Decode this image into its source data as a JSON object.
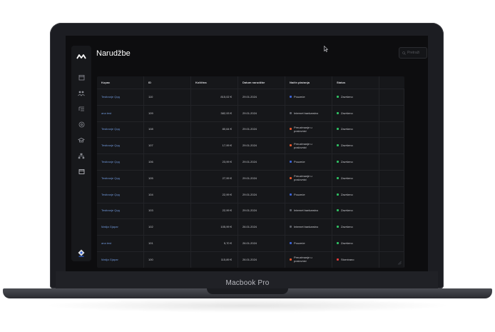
{
  "brand": "Macbook Pro",
  "page_title": "Narudžbe",
  "search": {
    "placeholder": "Pretraži"
  },
  "sidebar": {
    "items": [
      {
        "icon": "calendar-icon"
      },
      {
        "icon": "users-icon"
      },
      {
        "icon": "list-icon"
      },
      {
        "icon": "coin-icon"
      },
      {
        "icon": "graduation-cap-icon"
      },
      {
        "icon": "hierarchy-icon"
      },
      {
        "icon": "window-icon"
      }
    ]
  },
  "colors": {
    "accent": "#6e95d6",
    "paid_card": "#3b63d6",
    "bank": "#5d6068",
    "transfer": "#e8572c",
    "completed": "#2fbf62",
    "cancelled": "#e23b3b"
  },
  "table": {
    "headers": [
      "Kupac",
      "ID",
      "Količina",
      "Datum narudžbe",
      "Način plaćanja",
      "Status"
    ],
    "rows": [
      {
        "customer": "Testiranje Qqq",
        "id": "110",
        "amount": "815,02 €",
        "date": "29.01.2024",
        "payment": "Pouzeće",
        "payment_color": "blue",
        "status": "Završeno",
        "status_color": "green"
      },
      {
        "customer": "ana test",
        "id": "109",
        "amount": "382,93 €",
        "date": "29.01.2024",
        "payment": "Internet bankarstvo",
        "payment_color": "gray",
        "status": "Završeno",
        "status_color": "green"
      },
      {
        "customer": "Testiranje Qqq",
        "id": "108",
        "amount": "80,64 €",
        "date": "29.01.2024",
        "payment": "Preuzimanje u poslovnici",
        "payment_color": "orange",
        "status": "Završeno",
        "status_color": "green"
      },
      {
        "customer": "Testiranje Qqq",
        "id": "107",
        "amount": "17,99 €",
        "date": "29.01.2024",
        "payment": "Preuzimanje u poslovnici",
        "payment_color": "orange",
        "status": "Završeno",
        "status_color": "green"
      },
      {
        "customer": "Testiranje Qqq",
        "id": "106",
        "amount": "23,99 €",
        "date": "29.01.2024",
        "payment": "Pouzeće",
        "payment_color": "blue",
        "status": "Završeno",
        "status_color": "green"
      },
      {
        "customer": "Testiranje Qqq",
        "id": "105",
        "amount": "27,99 €",
        "date": "29.01.2024",
        "payment": "Preuzimanje u poslovnici",
        "payment_color": "orange",
        "status": "Završeno",
        "status_color": "green"
      },
      {
        "customer": "Testiranje Qqq",
        "id": "104",
        "amount": "22,99 €",
        "date": "29.01.2024",
        "payment": "Pouzeće",
        "payment_color": "blue",
        "status": "Završeno",
        "status_color": "green"
      },
      {
        "customer": "Testiranje Qqq",
        "id": "103",
        "amount": "22,99 €",
        "date": "29.01.2024",
        "payment": "Internet bankarstvo",
        "payment_color": "gray",
        "status": "Završeno",
        "status_color": "green"
      },
      {
        "customer": "Matija Gjapar",
        "id": "102",
        "amount": "105,99 €",
        "date": "26.01.2024",
        "payment": "Internet bankarstvo",
        "payment_color": "gray",
        "status": "Završeno",
        "status_color": "green"
      },
      {
        "customer": "ana test",
        "id": "101",
        "amount": "5,70 €",
        "date": "26.01.2024",
        "payment": "Pouzeće",
        "payment_color": "blue",
        "status": "Završeno",
        "status_color": "green"
      },
      {
        "customer": "Matija Gjapar",
        "id": "100",
        "amount": "115,89 €",
        "date": "26.01.2024",
        "payment": "Preuzimanje u poslovnici",
        "payment_color": "orange",
        "status": "Stornirano",
        "status_color": "red"
      }
    ]
  }
}
